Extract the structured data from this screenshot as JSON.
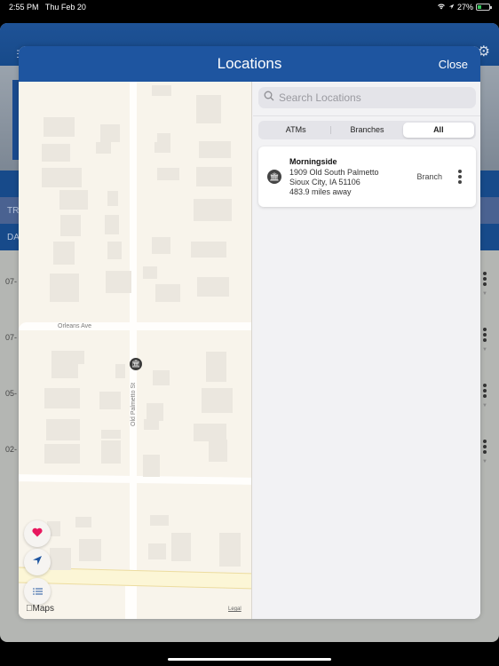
{
  "status_bar": {
    "time": "2:55 PM",
    "date": "Thu Feb 20",
    "battery": "27%",
    "battery_level": 0.27,
    "icons": [
      "wifi-icon",
      "location-arrow-icon",
      "battery-charging-icon"
    ]
  },
  "background_app": {
    "header_left_icon": "hamburger-menu-icon",
    "header_right_icon": "gear-icon",
    "band_labels": [
      "TR",
      "DAT"
    ],
    "rows": [
      {
        "date": "07-"
      },
      {
        "date": "07-"
      },
      {
        "date": "05-"
      },
      {
        "date": "02-"
      }
    ]
  },
  "modal": {
    "title": "Locations",
    "close_label": "Close"
  },
  "map": {
    "road_labels": {
      "orleans": "Orleans Ave",
      "palmetto": "Old Palmetto St"
    },
    "pin_icon": "bank-icon",
    "buttons": {
      "favorites": "heart-icon",
      "locate": "location-arrow-icon",
      "list": "list-icon"
    },
    "attribution": "Maps",
    "legal": "Legal"
  },
  "panel": {
    "search": {
      "placeholder": "Search Locations",
      "value": ""
    },
    "filters": [
      {
        "label": "ATMs",
        "active": false
      },
      {
        "label": "Branches",
        "active": false
      },
      {
        "label": "All",
        "active": true
      }
    ],
    "locations": [
      {
        "name": "Morningside",
        "address_line1": "1909 Old South Palmetto",
        "address_line2": "Sioux City, IA 51106",
        "distance": "483.9 miles away",
        "type": "Branch",
        "icon": "bank-icon"
      }
    ]
  }
}
